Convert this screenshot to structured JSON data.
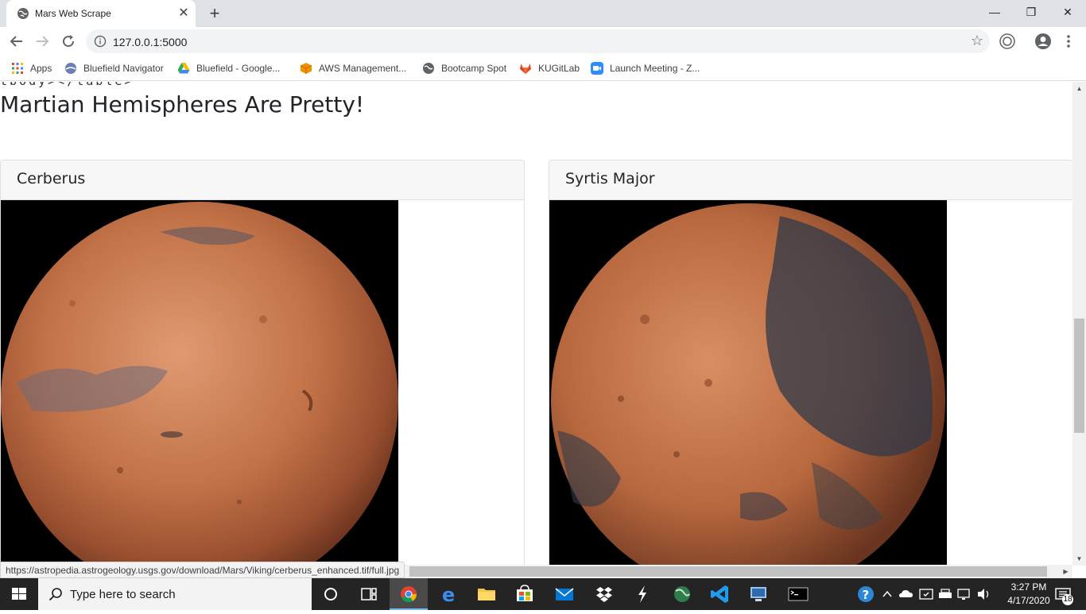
{
  "browser": {
    "tab_title": "Mars Web Scrape",
    "tab_close": "✕",
    "new_tab": "+",
    "window_controls": {
      "minimize": "—",
      "restore": "❐",
      "close": "✕"
    },
    "url": "127.0.0.1:5000",
    "status_url": "https://astropedia.astrogeology.usgs.gov/download/Mars/Viking/cerberus_enhanced.tif/full.jpg"
  },
  "bookmarks": [
    {
      "label": "Apps",
      "icon": "apps-grid-icon"
    },
    {
      "label": "Bluefield Navigator",
      "icon": "bluefield-navigator-icon"
    },
    {
      "label": "Bluefield - Google...",
      "icon": "google-drive-icon"
    },
    {
      "label": "AWS Management...",
      "icon": "aws-icon"
    },
    {
      "label": "Bootcamp Spot",
      "icon": "globe-icon"
    },
    {
      "label": "KUGitLab",
      "icon": "gitlab-icon"
    },
    {
      "label": "Launch Meeting - Z...",
      "icon": "zoom-icon"
    }
  ],
  "page": {
    "leftover_text": "tbody></table>",
    "heading": "Martian Hemispheres Are Pretty!",
    "cards": [
      {
        "title": "Cerberus"
      },
      {
        "title": "Syrtis Major"
      }
    ]
  },
  "taskbar": {
    "search_placeholder": "Type here to search",
    "time": "3:27 PM",
    "date": "4/17/2020",
    "notifications": "18"
  },
  "colors": {
    "mars_light": "#d9926a",
    "mars_mid": "#b9643c",
    "mars_dark": "#7a3d22",
    "mars_shadow": "#3c4a5a"
  }
}
